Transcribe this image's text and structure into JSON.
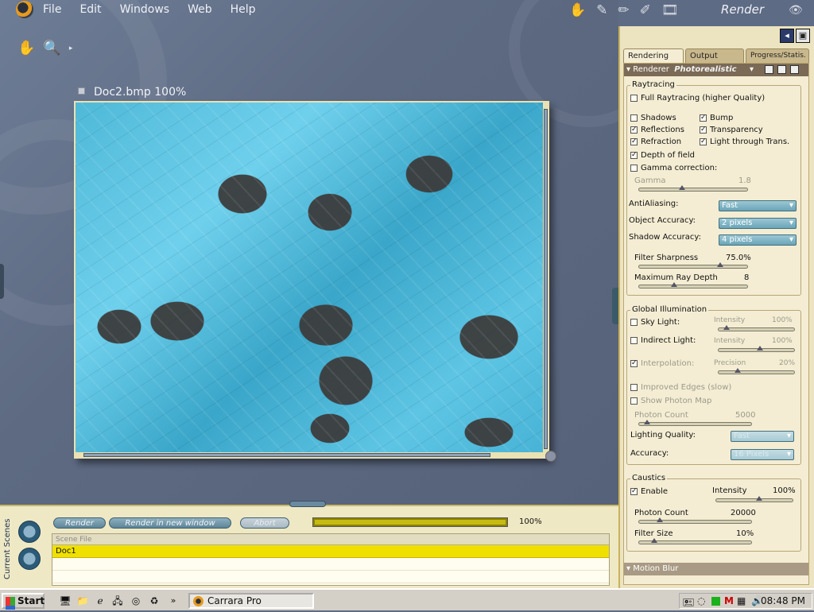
{
  "menubar": {
    "items": [
      "File",
      "Edit",
      "Windows",
      "Web",
      "Help"
    ],
    "room": "Render"
  },
  "document": {
    "title": "Doc2.bmp 100%"
  },
  "bottom": {
    "vertical_label": "Current Scenes",
    "buttons": {
      "render": "Render",
      "render_new": "Render in new window",
      "abort": "Abort"
    },
    "progress_pct": "100%",
    "progress_value": 1.0,
    "table": {
      "header": "Scene File",
      "rows": [
        "Doc1"
      ]
    }
  },
  "panel": {
    "tabs": [
      "Rendering",
      "Output",
      "Progress/Statis."
    ],
    "renderer": {
      "label": "Renderer",
      "mode": "Photorealistic"
    },
    "raytracing": {
      "title": "Raytracing",
      "full": "Full Raytracing (higher Quality)",
      "shadows": "Shadows",
      "bump": "Bump",
      "reflections": "Reflections",
      "transparency": "Transparency",
      "refraction": "Refraction",
      "light_through": "Light through Trans.",
      "dof": "Depth of field",
      "gamma_corr": "Gamma correction:",
      "gamma_label": "Gamma",
      "gamma_val": "1.8",
      "aa_label": "AntiAliasing:",
      "aa_val": "Fast",
      "obj_label": "Object Accuracy:",
      "obj_val": "2 pixels",
      "shadow_label": "Shadow Accuracy:",
      "shadow_val": "4 pixels",
      "filter_label": "Filter Sharpness",
      "filter_val": "75.0%",
      "filter_level": 0.75,
      "depth_label": "Maximum Ray Depth",
      "depth_val": "8"
    },
    "gi": {
      "title": "Global Illumination",
      "sky": "Sky Light:",
      "indirect": "Indirect Light:",
      "interp": "Interpolation:",
      "intensity": "Intensity",
      "precision": "Precision",
      "sky_val": "100%",
      "ind_val": "100%",
      "prec_val": "20%",
      "improved": "Improved Edges (slow)",
      "photon_map": "Show Photon Map",
      "photon_count": "Photon Count",
      "photon_count_val": "5000",
      "lq_label": "Lighting Quality:",
      "lq_val": "Fast",
      "acc_label": "Accuracy:",
      "acc_val": "16 Pixels"
    },
    "caustics": {
      "title": "Caustics",
      "enable": "Enable",
      "intensity": "Intensity",
      "int_val": "100%",
      "photon_count": "Photon Count",
      "pc_val": "20000",
      "filter": "Filter Size",
      "filter_val": "10%"
    },
    "motion_blur": "Motion Blur"
  },
  "taskbar": {
    "start": "Start",
    "task": "Carrara Pro",
    "clock": "08:48 PM"
  }
}
